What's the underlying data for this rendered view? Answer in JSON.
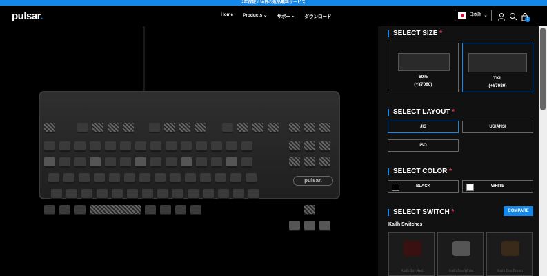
{
  "promo": {
    "text": "2年保証 / 30日の返品無料サービス"
  },
  "nav": {
    "logo": "pulsar",
    "logo_dot": ".",
    "links": [
      "Home",
      "Products",
      "サポート",
      "ダウンロード"
    ],
    "language": "日本語",
    "cart_count": "1",
    "icons": [
      "user-icon",
      "search-icon",
      "bag-icon"
    ]
  },
  "product": {
    "brand_plate": "pulsar."
  },
  "panel": {
    "size": {
      "title": "SELECT SIZE",
      "req": "*",
      "options": [
        {
          "name": "60%",
          "price": "(+¥7080)",
          "selected": false
        },
        {
          "name": "TKL",
          "price": "(+¥7080)",
          "selected": true
        }
      ]
    },
    "layout": {
      "title": "SELECT LAYOUT",
      "req": "*",
      "options": [
        "JIS",
        "US/ANSI",
        "ISO"
      ],
      "selected": "JIS"
    },
    "color": {
      "title": "SELECT COLOR",
      "req": "*",
      "options": [
        "BLACK",
        "WHITE"
      ]
    },
    "switch": {
      "title": "SELECT SWITCH",
      "req": "*",
      "compare": "COMPARE",
      "group": "Kailh Switches",
      "cards": [
        "Kailh Box Red",
        "Kailh Box White",
        "Kailh Box Brown"
      ]
    }
  },
  "colors": {
    "accent": "#1487ea",
    "required": "#e8405a",
    "panel_bg": "#111111"
  }
}
